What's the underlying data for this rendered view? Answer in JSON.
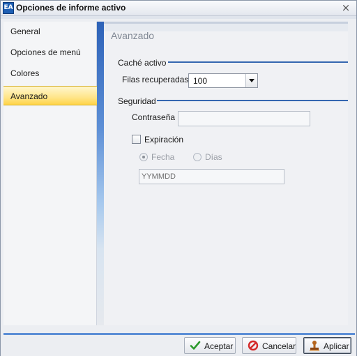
{
  "window": {
    "title": "Opciones de informe activo",
    "icon": "app-icon",
    "icon_text": "EA",
    "close_glyph": "×"
  },
  "sidebar": {
    "items": [
      {
        "label": "General",
        "active": false
      },
      {
        "label": "Opciones de menú",
        "active": false
      },
      {
        "label": "Colores",
        "active": false
      },
      {
        "label": "Avanzado",
        "active": true
      }
    ]
  },
  "content": {
    "title": "Avanzado",
    "cache": {
      "label": "Caché activo",
      "rows_label": "Filas recuperadas",
      "rows_value": "100"
    },
    "security": {
      "label": "Seguridad",
      "password_label": "Contraseña",
      "password_value": "",
      "expiration_label": "Expiración",
      "expiration_checked": false,
      "radio_date_label": "Fecha",
      "radio_days_label": "Días",
      "date_placeholder": "YYMMDD"
    }
  },
  "footer": {
    "accept_label": "Aceptar",
    "cancel_label": "Cancelar",
    "apply_label": "Aplicar"
  },
  "colors": {
    "accent": "#3466b0",
    "active_nav": "#ffd447"
  }
}
